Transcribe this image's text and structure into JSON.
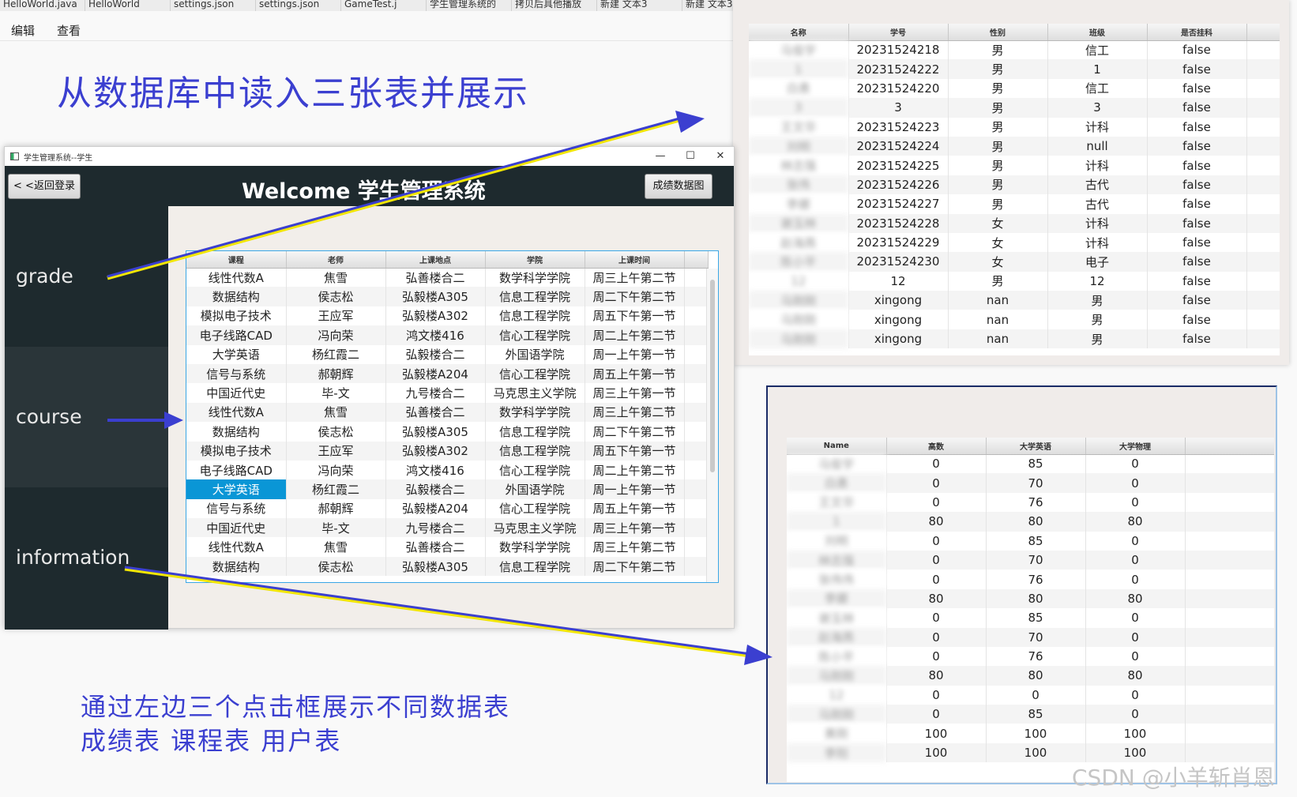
{
  "editor": {
    "tabs": [
      "HelloWorld.java",
      "HelloWorld",
      "settings.json",
      "settings.json",
      "GameTest.j",
      "学生管理系统的",
      "拷贝后具他播放",
      "新建 文本3",
      "新建 文本3"
    ],
    "menu": [
      "编辑",
      "查看"
    ]
  },
  "captions": {
    "top": "从数据库中读入三张表并展示",
    "bottom_line1": "通过左边三个点击框展示不同数据表",
    "bottom_line2": "成绩表  课程表  用户表"
  },
  "app": {
    "window_title": "学生管理系统--学生",
    "controls": [
      "—",
      "☐",
      "✕"
    ],
    "back_button": "< <返回登录",
    "welcome": "Welcome 学生管理系统",
    "chart_button": "成绩数据图",
    "sidebar": [
      "grade",
      "course",
      "information"
    ],
    "course_table": {
      "columns": [
        "课程",
        "老师",
        "上课地点",
        "学院",
        "上课时间"
      ],
      "selected_row": 11,
      "rows": [
        [
          "线性代数A",
          "焦雪",
          "弘善楼合二",
          "数学科学学院",
          "周三上午第二节"
        ],
        [
          "数据结构",
          "侯志松",
          "弘毅楼A305",
          "信息工程学院",
          "周二下午第二节"
        ],
        [
          "模拟电子技术",
          "王应军",
          "弘毅楼A302",
          "信息工程学院",
          "周五下午第一节"
        ],
        [
          "电子线路CAD",
          "冯向荣",
          "鸿文楼416",
          "信心工程学院",
          "周二上午第二节"
        ],
        [
          "大学英语",
          "杨红霞二",
          "弘毅楼合二",
          "外国语学院",
          "周一上午第一节"
        ],
        [
          "信号与系统",
          "郝朝辉",
          "弘毅楼A204",
          "信心工程学院",
          "周五上午第一节"
        ],
        [
          "中国近代史",
          "毕-文",
          "九号楼合二",
          "马克思主义学院",
          "周三上午第一节"
        ],
        [
          "线性代数A",
          "焦雪",
          "弘善楼合二",
          "数学科学学院",
          "周三上午第二节"
        ],
        [
          "数据结构",
          "侯志松",
          "弘毅楼A305",
          "信息工程学院",
          "周二下午第二节"
        ],
        [
          "模拟电子技术",
          "王应军",
          "弘毅楼A302",
          "信息工程学院",
          "周五下午第一节"
        ],
        [
          "电子线路CAD",
          "冯向荣",
          "鸿文楼416",
          "信心工程学院",
          "周二上午第二节"
        ],
        [
          "大学英语",
          "杨红霞二",
          "弘毅楼合二",
          "外国语学院",
          "周一上午第一节"
        ],
        [
          "信号与系统",
          "郝朝辉",
          "弘毅楼A204",
          "信心工程学院",
          "周五上午第一节"
        ],
        [
          "中国近代史",
          "毕-文",
          "九号楼合二",
          "马克思主义学院",
          "周三上午第一节"
        ],
        [
          "线性代数A",
          "焦雪",
          "弘善楼合二",
          "数学科学学院",
          "周三上午第二节"
        ],
        [
          "数据结构",
          "侯志松",
          "弘毅楼A305",
          "信息工程学院",
          "周二下午第二节"
        ]
      ]
    }
  },
  "student_table": {
    "columns": [
      "名称",
      "学号",
      "性别",
      "班级",
      "是否挂科"
    ],
    "rows": [
      [
        "马俊宇",
        "20231524218",
        "男",
        "信工",
        "false"
      ],
      [
        "1",
        "20231524222",
        "男",
        "1",
        "false"
      ],
      [
        "白勇",
        "20231524220",
        "男",
        "信工",
        "false"
      ],
      [
        "3",
        "3",
        "男",
        "3",
        "false"
      ],
      [
        "王文华",
        "20231524223",
        "男",
        "计科",
        "false"
      ],
      [
        "刘明",
        "20231524224",
        "男",
        "null",
        "false"
      ],
      [
        "林志强",
        "20231524225",
        "男",
        "计科",
        "false"
      ],
      [
        "张伟",
        "20231524226",
        "男",
        "古代",
        "false"
      ],
      [
        "李娜",
        "20231524227",
        "男",
        "古代",
        "false"
      ],
      [
        "谢玉林",
        "20231524228",
        "女",
        "计科",
        "false"
      ],
      [
        "赵海燕",
        "20231524229",
        "女",
        "计科",
        "false"
      ],
      [
        "陈小平",
        "20231524230",
        "女",
        "电子",
        "false"
      ],
      [
        "12",
        "12",
        "男",
        "12",
        "false"
      ],
      [
        "马刚刚",
        "xingong",
        "nan",
        "男",
        "false"
      ],
      [
        "马刚刚",
        "xingong",
        "nan",
        "男",
        "false"
      ],
      [
        "马刚刚",
        "xingong",
        "nan",
        "男",
        "false"
      ]
    ]
  },
  "grade_table": {
    "columns": [
      "Name",
      "高数",
      "大学英语",
      "大学物理"
    ],
    "rows": [
      [
        "马俊宇",
        "0",
        "85",
        "0"
      ],
      [
        "白勇",
        "0",
        "70",
        "0"
      ],
      [
        "王文华",
        "0",
        "76",
        "0"
      ],
      [
        "1",
        "80",
        "80",
        "80"
      ],
      [
        "刘明",
        "0",
        "85",
        "0"
      ],
      [
        "林志强",
        "0",
        "70",
        "0"
      ],
      [
        "张伟伟",
        "0",
        "76",
        "0"
      ],
      [
        "李娜",
        "80",
        "80",
        "80"
      ],
      [
        "谢玉林",
        "0",
        "85",
        "0"
      ],
      [
        "赵海燕",
        "0",
        "70",
        "0"
      ],
      [
        "陈小平",
        "0",
        "76",
        "0"
      ],
      [
        "马刚刚",
        "80",
        "80",
        "80"
      ],
      [
        "12",
        "0",
        "0",
        "0"
      ],
      [
        "马刚刚",
        "0",
        "85",
        "0"
      ],
      [
        "黄刚",
        "100",
        "100",
        "100"
      ],
      [
        "李阳",
        "100",
        "100",
        "100"
      ]
    ]
  },
  "watermark": "CSDN @小羊斩肖恩",
  "colors": {
    "caption": "#3b3fd0",
    "arrow_fill": "#3b3fd0",
    "arrow_edge": "#f2e600",
    "selection": "#0a96d6",
    "sidebar": "#1e2a2e"
  }
}
